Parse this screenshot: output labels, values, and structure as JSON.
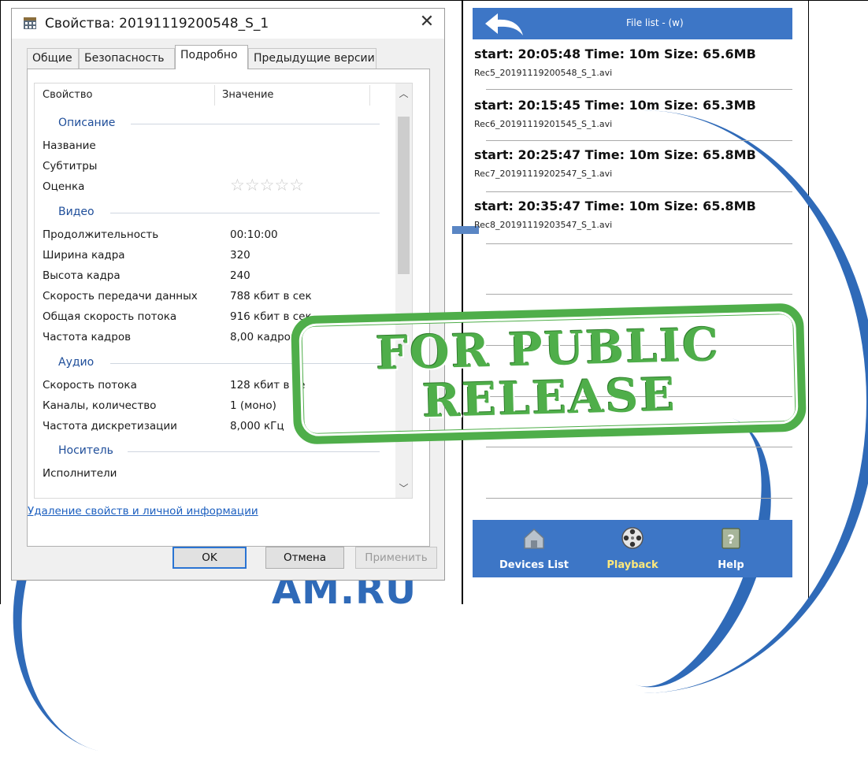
{
  "watermark": {
    "text": "AM.RU"
  },
  "dialog": {
    "title": "Свойства: 20191119200548_S_1",
    "close_glyph": "✕",
    "tabs": [
      {
        "label": "Общие"
      },
      {
        "label": "Безопасность"
      },
      {
        "label": "Подробно",
        "active": true
      },
      {
        "label": "Предыдущие версии"
      }
    ],
    "columns": {
      "property": "Свойство",
      "value": "Значение"
    },
    "groups": {
      "description": "Описание",
      "video": "Видео",
      "audio": "Аудио",
      "media": "Носитель"
    },
    "rows": {
      "name": "Название",
      "subtitle": "Субтитры",
      "rating": "Оценка",
      "rating_value": "☆☆☆☆☆",
      "duration": "Продолжительность",
      "duration_value": "00:10:00",
      "frame_width": "Ширина кадра",
      "frame_width_value": "320",
      "frame_height": "Высота кадра",
      "frame_height_value": "240",
      "data_rate": "Скорость передачи данных",
      "data_rate_value": "788 кбит в сек",
      "total_bitrate": "Общая скорость потока",
      "total_bitrate_value": "916 кбит в сек",
      "frame_rate": "Частота кадров",
      "frame_rate_value": "8,00 кадров/",
      "bitrate": "Скорость потока",
      "bitrate_value": "128 кбит в се",
      "channels": "Каналы, количество",
      "channels_value": "1 (моно)",
      "sample_rate": "Частота дискретизации",
      "sample_rate_value": "8,000 кГц",
      "artists": "Исполнители"
    },
    "remove_link": "Удаление свойств и личной информации",
    "buttons": {
      "ok": "OK",
      "cancel": "Отмена",
      "apply": "Применить"
    }
  },
  "phone": {
    "title": "File list - (w)",
    "files": [
      {
        "head": "start: 20:05:48  Time: 10m  Size: 65.6MB",
        "name": "Rec5_20191119200548_S_1.avi"
      },
      {
        "head": "start: 20:15:45  Time: 10m  Size: 65.3MB",
        "name": "Rec6_20191119201545_S_1.avi"
      },
      {
        "head": "start: 20:25:47  Time: 10m  Size: 65.8MB",
        "name": "Rec7_20191119202547_S_1.avi"
      },
      {
        "head": "start: 20:35:47  Time: 10m  Size: 65.8MB",
        "name": "Rec8_20191119203547_S_1.avi"
      }
    ],
    "tabbar": {
      "devices": "Devices List",
      "playback": "Playback",
      "help": "Help"
    }
  },
  "stamp": {
    "line1": "FOR PUBLIC",
    "line2": "RELEASE"
  },
  "colors": {
    "phone_blue": "#3d76c6",
    "stamp_green": "#4fae4a",
    "link_blue": "#1c5fbf",
    "active_tab_label": "#ffe97a"
  }
}
